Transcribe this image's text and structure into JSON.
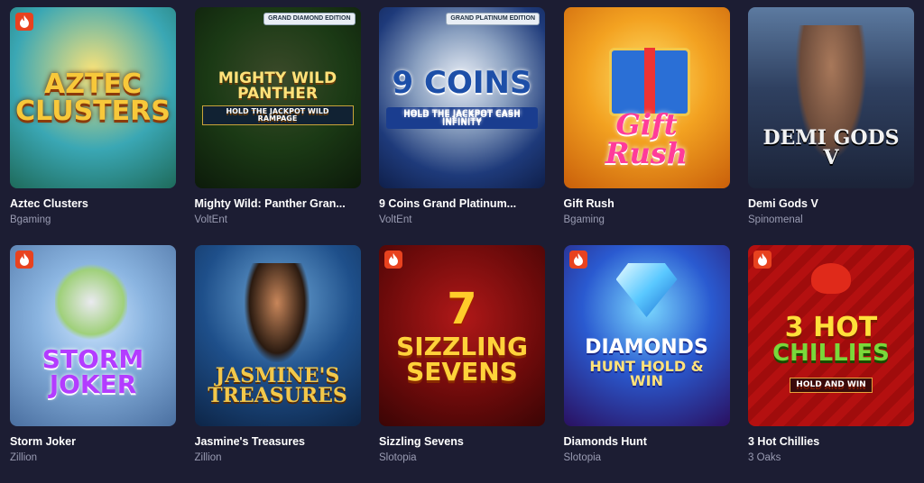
{
  "games": [
    {
      "title": "Aztec Clusters",
      "provider": "Bgaming",
      "hot": true,
      "art": {
        "title": "AZTEC CLUSTERS"
      }
    },
    {
      "title": "Mighty Wild: Panther Gran...",
      "provider": "VoltEnt",
      "hot": false,
      "art": {
        "title": "MIGHTY WILD PANTHER",
        "sub": "HOLD THE JACKPOT WILD RAMPAGE",
        "badge": "GRAND DIAMOND EDITION"
      }
    },
    {
      "title": "9 Coins Grand Platinum...",
      "provider": "VoltEnt",
      "hot": false,
      "art": {
        "title": "9 COINS",
        "sub": "HOLD THE JACKPOT CASH INFINITY",
        "badge": "GRAND PLATINUM EDITION"
      }
    },
    {
      "title": "Gift Rush",
      "provider": "Bgaming",
      "hot": false,
      "art": {
        "title": "Gift Rush"
      }
    },
    {
      "title": "Demi Gods V",
      "provider": "Spinomenal",
      "hot": false,
      "art": {
        "title": "DEMI GODS V"
      }
    },
    {
      "title": "Storm Joker",
      "provider": "Zillion",
      "hot": true,
      "art": {
        "title": "STORM JOKER"
      }
    },
    {
      "title": "Jasmine's Treasures",
      "provider": "Zillion",
      "hot": false,
      "art": {
        "title": "JASMINE'S TREASURES"
      }
    },
    {
      "title": "Sizzling Sevens",
      "provider": "Slotopia",
      "hot": true,
      "art": {
        "title": "SIZZLING SEVENS",
        "seven": "7"
      }
    },
    {
      "title": "Diamonds Hunt",
      "provider": "Slotopia",
      "hot": true,
      "art": {
        "title": "DIAMONDS",
        "sub": "HUNT HOLD & WIN"
      }
    },
    {
      "title": "3 Hot Chillies",
      "provider": "3 Oaks",
      "hot": true,
      "art": {
        "title": "3 HOT",
        "chill": "CHILLIES",
        "sub": "HOLD AND WIN"
      }
    }
  ]
}
